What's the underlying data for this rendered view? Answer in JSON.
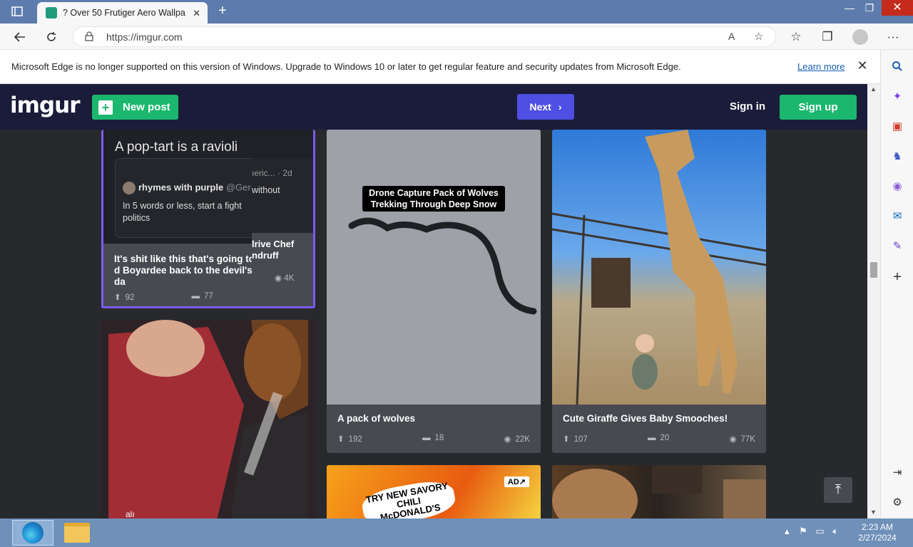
{
  "browser": {
    "tab_title": "? Over 50 Frutiger Aero Wallpap",
    "tab_close": "✕",
    "new_tab": "+",
    "url": "https://imgur.com",
    "window_buttons": {
      "minimize": "—",
      "restore": "❐",
      "close": "✕"
    }
  },
  "infobar": {
    "message": "Microsoft Edge is no longer supported on this version of Windows. Upgrade to Windows 10 or later to get regular feature and security updates from Microsoft Edge.",
    "learn_more": "Learn more",
    "close": "✕"
  },
  "imgur": {
    "logo": "imgur",
    "new_post": "New post",
    "next": "Next",
    "sign_in": "Sign in",
    "sign_up": "Sign up"
  },
  "cards": {
    "tweet": {
      "headline": "A pop-tart is a ravioli",
      "user": "rhymes with purple",
      "handle": "@Ger",
      "body": "In 5 words or less, start a fight politics",
      "title": "It's shit like this that's going to d Boyardee back to the devil's da",
      "upvotes": "92",
      "comments": "77"
    },
    "tweet_overlap": {
      "meta": "ıeric... · 2d",
      "word": "without",
      "title": "lrive Chef ndruff",
      "views": "4K"
    },
    "wolves": {
      "caption": "Drone Capture Pack of Wolves Trekking Through Deep Snow",
      "title": "A pack of wolves",
      "upvotes": "192",
      "comments": "18",
      "views": "22K"
    },
    "giraffe": {
      "title": "Cute Giraffe Gives Baby Smooches!",
      "upvotes": "107",
      "comments": "20",
      "views": "77K"
    },
    "ad": {
      "badge": "AD↗",
      "text": "TRY NEW SAVORY CHILI McDONALD'S"
    },
    "dog": {
      "overlay": "alı"
    }
  },
  "taskbar": {
    "time": "2:23 AM",
    "date": "2/27/2024"
  },
  "colors": {
    "imgur_green": "#1bb76e",
    "imgur_next": "#4f4fe3",
    "imgur_header": "#1b1c3a",
    "card_bg": "#474a51"
  }
}
